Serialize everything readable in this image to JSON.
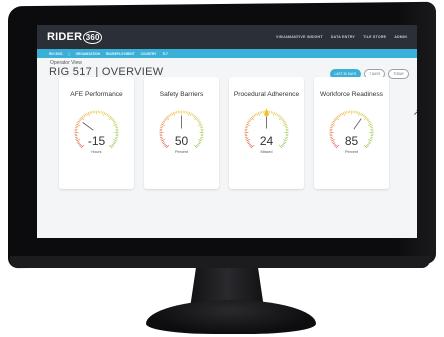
{
  "app": {
    "logo_text": "RIDER",
    "logo_number": "360"
  },
  "topnav": [
    "VISUAMANTIVE INSIGHT",
    "DATA ENTRY",
    "TILE STORE",
    "ADMIN"
  ],
  "subnav": [
    "RIG 5001",
    "ORGANIZATION",
    "RIG/DEPLOYMENT",
    "COUNTRY",
    "TLT"
  ],
  "page": {
    "title": "RIG 517 | OVERVIEW",
    "subtitle": "Operator View",
    "buttons": [
      "LAST 30 DAYS",
      "7 DAYS",
      "TODAY"
    ]
  },
  "gauges": [
    {
      "title": "AFE Performance",
      "value": "-15",
      "unit": "Hours",
      "level": 0.3
    },
    {
      "title": "Safety Barriers",
      "value": "50",
      "unit": "Percent",
      "level": 0.5
    },
    {
      "title": "Procedural Adherence",
      "value": "24",
      "unit": "Missed",
      "level": 0.5
    },
    {
      "title": "Workforce Readiness",
      "value": "85",
      "unit": "Percent",
      "level": 0.63
    }
  ],
  "colors": {
    "accent": "#3ab0d8",
    "topbar": "#2b2f38",
    "gauge_red": "#e0443a",
    "gauge_yellow": "#f2c22a",
    "gauge_green": "#7cc242"
  }
}
